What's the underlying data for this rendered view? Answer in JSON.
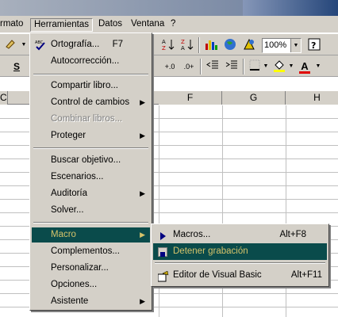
{
  "menubar": {
    "items": [
      {
        "label": "rmato"
      },
      {
        "label": "Herramientas"
      },
      {
        "label": "Datos"
      },
      {
        "label": "Ventana"
      },
      {
        "label": "?"
      }
    ]
  },
  "toolbar": {
    "zoom_value": "100%",
    "underline_label": "S",
    "font_color_label": "A"
  },
  "sheet": {
    "column_headers": [
      "C",
      "F",
      "G",
      "H"
    ]
  },
  "tools_menu": {
    "items": [
      {
        "label": "Ortografía...",
        "shortcut": "F7"
      },
      {
        "label": "Autocorrección..."
      },
      {
        "label": "Compartir libro..."
      },
      {
        "label": "Control de cambios"
      },
      {
        "label": "Combinar libros..."
      },
      {
        "label": "Proteger"
      },
      {
        "label": "Buscar objetivo..."
      },
      {
        "label": "Escenarios..."
      },
      {
        "label": "Auditoría"
      },
      {
        "label": "Solver..."
      },
      {
        "label": "Macro"
      },
      {
        "label": "Complementos..."
      },
      {
        "label": "Personalizar..."
      },
      {
        "label": "Opciones..."
      },
      {
        "label": "Asistente"
      }
    ],
    "spell_icon_text": "ABC"
  },
  "macro_submenu": {
    "items": [
      {
        "label": "Macros...",
        "shortcut": "Alt+F8"
      },
      {
        "label": "Detener grabación"
      },
      {
        "label": "Editor de Visual Basic",
        "shortcut": "Alt+F11"
      }
    ]
  },
  "colors": {
    "highlight_bg": "#0a4b4b",
    "highlight_text": "#d6c36a",
    "menu_bg": "#d4d0c8"
  }
}
